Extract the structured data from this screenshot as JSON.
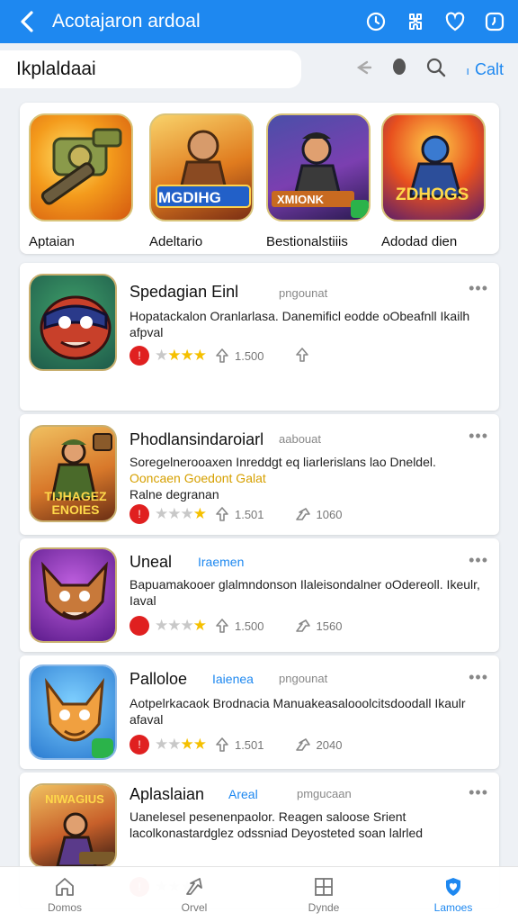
{
  "appbar": {
    "title": "Acotajaron ardoal"
  },
  "search": {
    "value": "Ikplaldaai",
    "cancel_label": "Calt"
  },
  "featured": [
    {
      "caption": "Aptaian",
      "art": "tank-art"
    },
    {
      "caption": "Adeltario",
      "art": "warrior-art",
      "logo": "MGDIHG"
    },
    {
      "caption": "Bestionalstiiis",
      "art": "soldier-art",
      "logo": "XMIONK"
    },
    {
      "caption": "Adodad dien",
      "art": "battle-art",
      "logo": "ZDHOGS"
    }
  ],
  "cards": [
    {
      "name": "Spedagian Einl",
      "developer": "pngounat",
      "description": "Hopatackalon Oranlarlasa. Danemificl eodde oObeafnll Ikailh afpval",
      "highlight": "",
      "subtitle": "",
      "rating": 3,
      "stat1": "1.500",
      "stat2": "",
      "art": "masked-hero-icon"
    },
    {
      "name": "Phodlansindaroiarl",
      "developer": "aabouat",
      "description": "Soregelnerooaxen Inreddgt eq liarlerislans lao Dneldel.",
      "highlight": "Ooncaen Goedont Galat",
      "subtitle": "Ralne degranan",
      "rating": 3,
      "stat1": "1.501",
      "stat2": "1060",
      "art": "commando-art",
      "logo": "TIJHAGEZ ENOIES"
    },
    {
      "name": "Uneal",
      "tag": "Iraemen",
      "developer": "",
      "description": "Bapuamakooer glalmndonson Ilaleisondalner oOdereoll. Ikeulr, Iaval",
      "highlight": "",
      "subtitle": "",
      "rating": 3,
      "stat1": "1.500",
      "stat2": "1560",
      "art": "fox-warrior-icon"
    },
    {
      "name": "Palloloe",
      "tag": "Iaienea",
      "developer": "pngounat",
      "description": "Aotpelrkacaok Brodnacia Manuakeasalooolcitsdoodall Ikaulr afaval",
      "highlight": "",
      "subtitle": "",
      "rating": 3,
      "stat1": "1.501",
      "stat2": "2040",
      "art": "cat-icon"
    },
    {
      "name": "Aplaslaian",
      "tag": "Areal",
      "developer": "pmgucaan",
      "description": "Uanelesel pesenenpaolor. Reagen saloose Srient lacolkonastardglez odssniad Deyosteted soan lalrled",
      "highlight": "",
      "subtitle": "",
      "rating": 2,
      "stat1": "",
      "stat2": "",
      "art": "pirate-art",
      "logo": "NIWAGIUS"
    }
  ],
  "bottomnav": [
    {
      "label": "Domos",
      "icon": "home-icon"
    },
    {
      "label": "Orvel",
      "icon": "share-icon"
    },
    {
      "label": "Dynde",
      "icon": "grid-icon"
    },
    {
      "label": "Lamoes",
      "icon": "shield-heart-icon"
    }
  ],
  "colors": {
    "primary": "#1e88f0",
    "star": "#f5c000",
    "badge": "#e02020"
  }
}
